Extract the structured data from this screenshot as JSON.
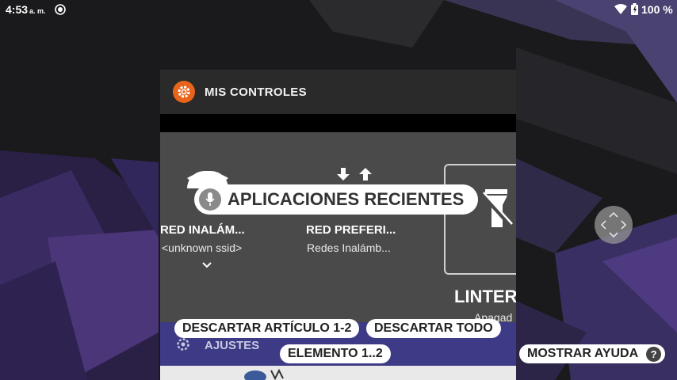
{
  "status_bar": {
    "time": "4:53",
    "ampm": "a. m.",
    "battery": "100 %"
  },
  "card": {
    "app_title": "MIS CONTROLES",
    "app_icon": "gear-icon",
    "accent_color": "#e9641b",
    "tiles": [
      {
        "title": "RED INALÁM...",
        "subtitle": "<unknown ssid>",
        "icon": "wifi-icon"
      },
      {
        "title": "RED PREFERI...",
        "subtitle": "Redes Inalámb...",
        "icon": "network-arrows-icon"
      },
      {
        "title": "LINTER",
        "subtitle": "Apagad",
        "icon": "flashlight-off-icon"
      }
    ],
    "settings_label": "AJUSTES",
    "settings_bar_color": "#3d3a86"
  },
  "overlay": {
    "recent_apps": "APLICACIONES RECIENTES",
    "dismiss_item": "DESCARTAR ARTÍCULO 1-2",
    "dismiss_all": "DESCARTAR TODO",
    "element_counter": "ELEMENTO 1..2",
    "show_help": "MOSTRAR AYUDA",
    "help_icon": "?"
  }
}
